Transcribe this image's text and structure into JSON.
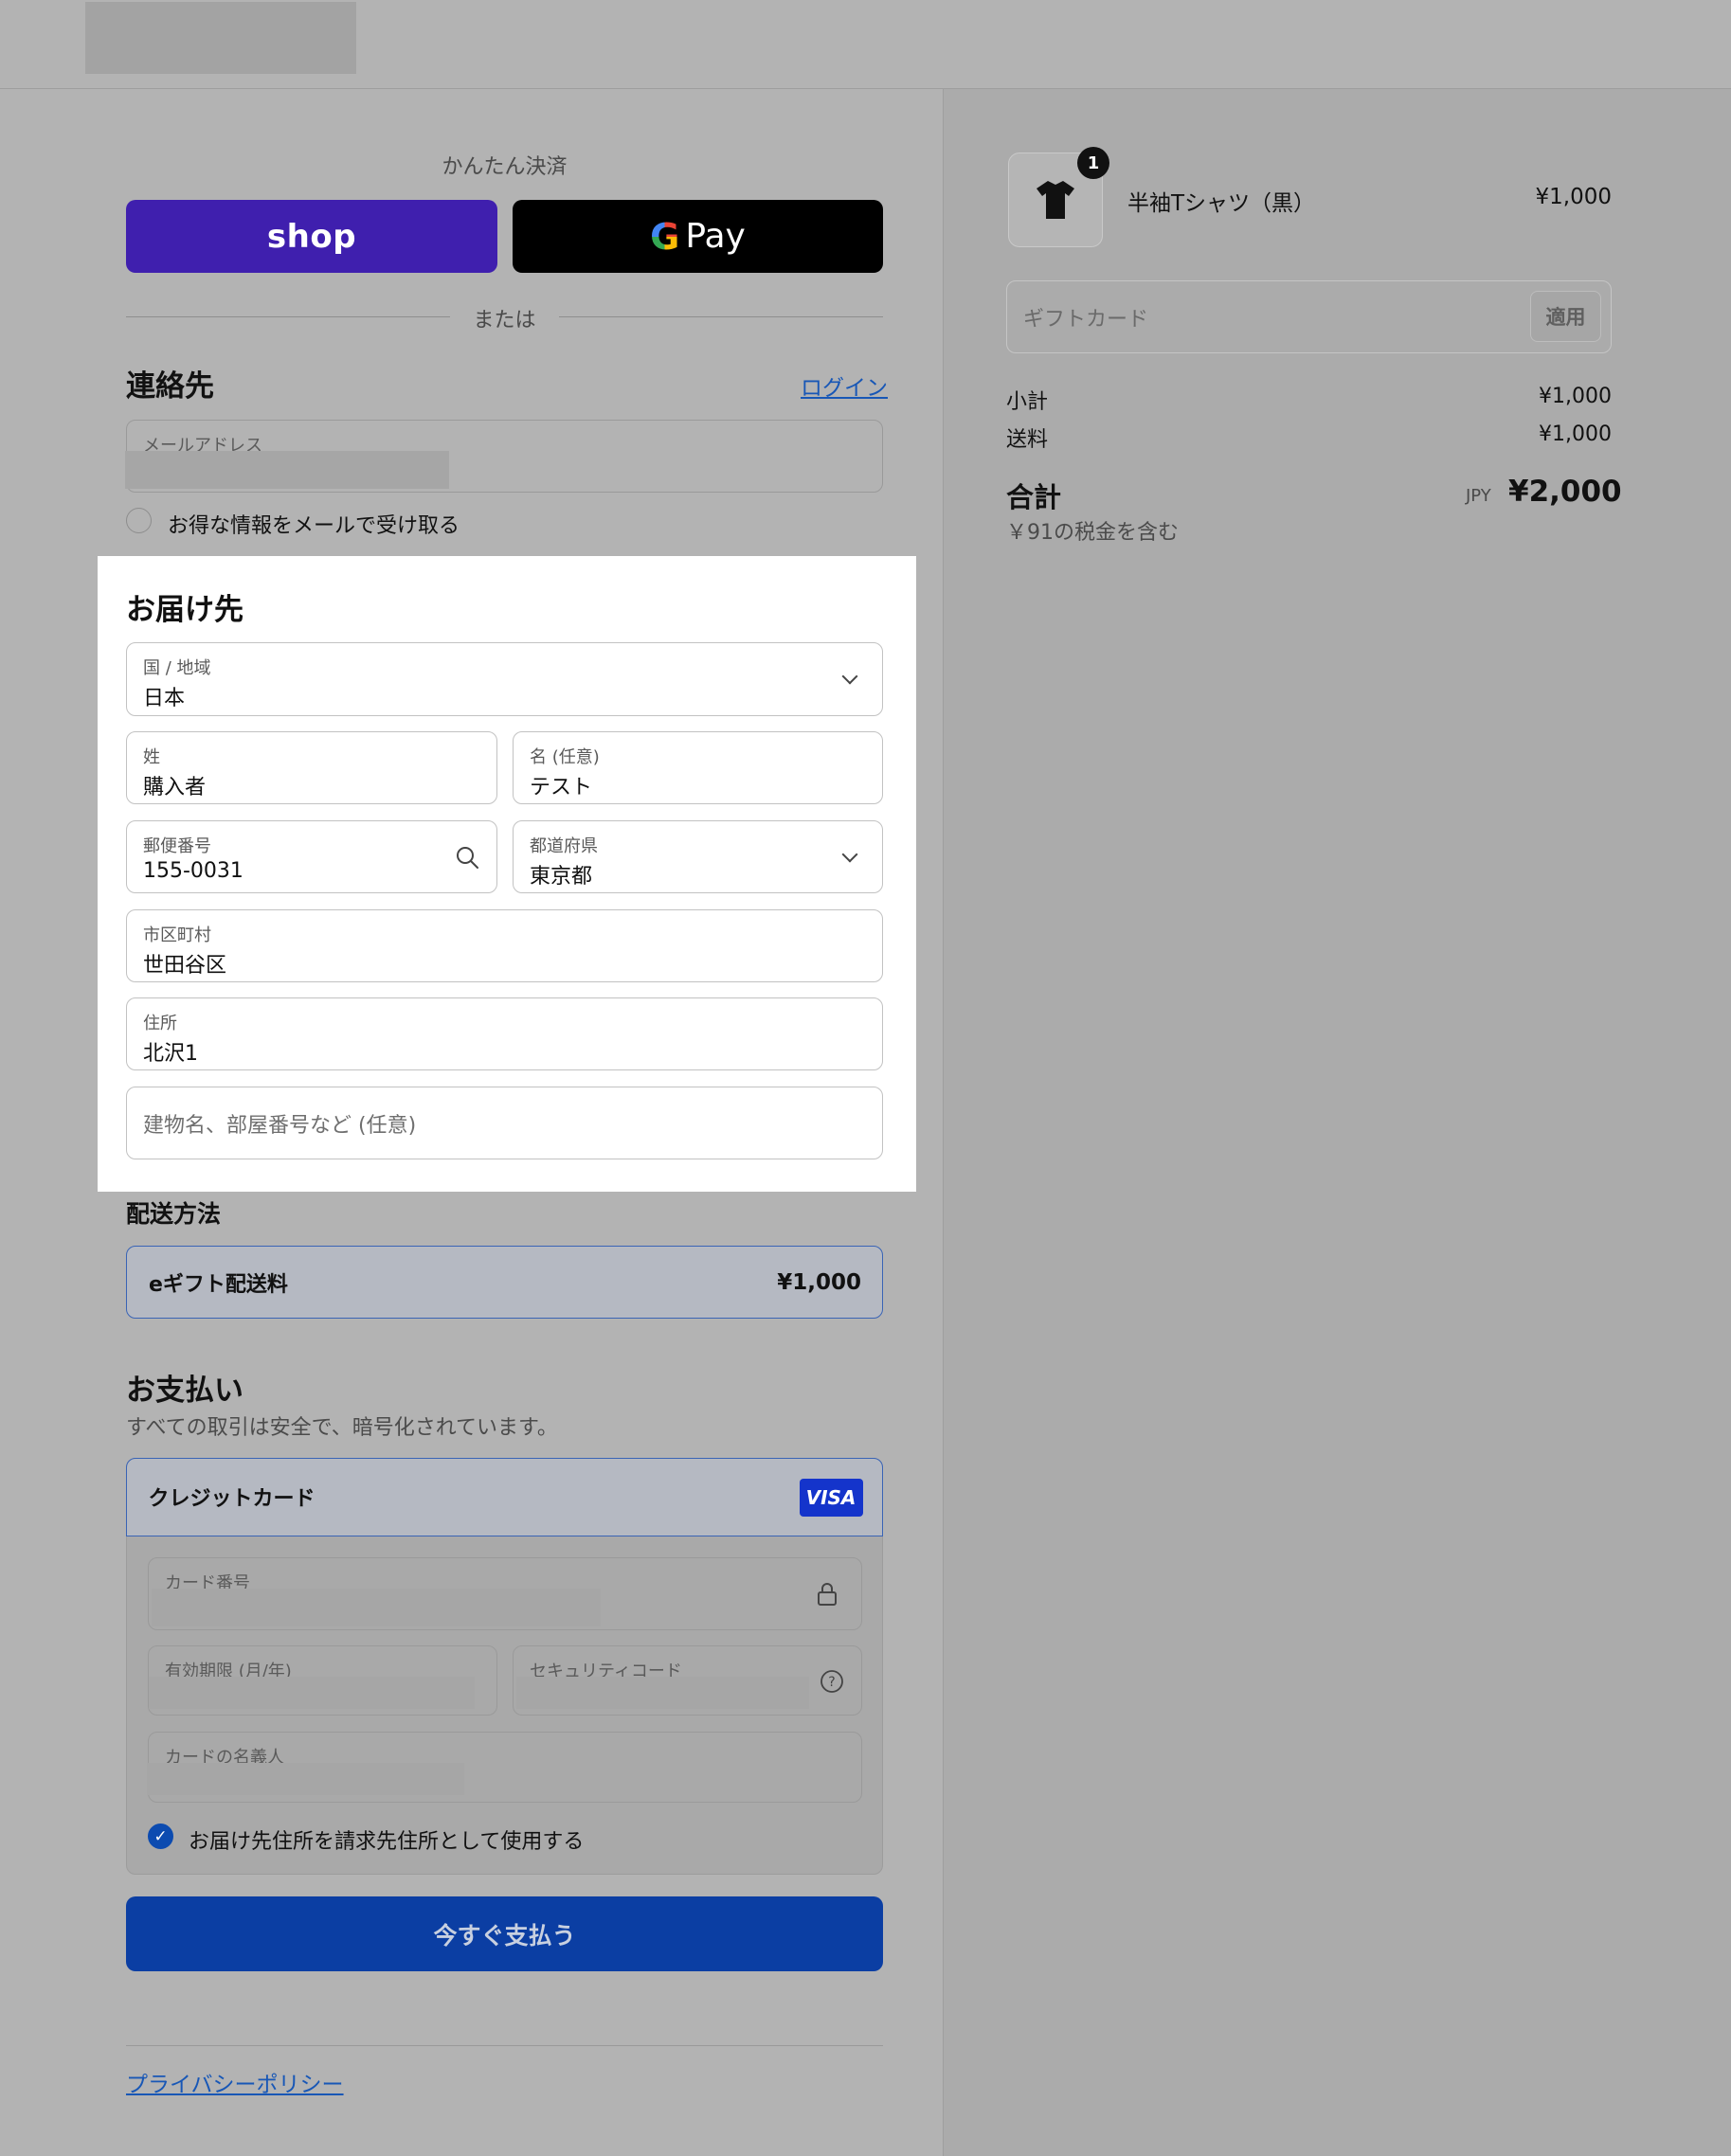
{
  "express": {
    "label": "かんたん決済",
    "shop_label": "shop",
    "gpay_g": "G",
    "gpay_label": "Pay"
  },
  "or_text": "または",
  "contact": {
    "heading": "連絡先",
    "login_link": "ログイン",
    "email_label": "メールアドレス",
    "newsletter_label": "お得な情報をメールで受け取る"
  },
  "delivery": {
    "heading": "お届け先",
    "country_label": "国 / 地域",
    "country_value": "日本",
    "last_name_label": "姓",
    "last_name_value": "購入者",
    "first_name_label": "名 (任意)",
    "first_name_value": "テスト",
    "postal_label": "郵便番号",
    "postal_value": "155-0031",
    "prefecture_label": "都道府県",
    "prefecture_value": "東京都",
    "city_label": "市区町村",
    "city_value": "世田谷区",
    "address_label": "住所",
    "address_value": "北沢1",
    "building_placeholder": "建物名、部屋番号など (任意)"
  },
  "shipping": {
    "heading": "配送方法",
    "method_name": "eギフト配送料",
    "method_price": "¥1,000"
  },
  "payment": {
    "heading": "お支払い",
    "subtitle": "すべての取引は安全で、暗号化されています。",
    "method_label": "クレジットカード",
    "card_brand": "VISA",
    "card_number_label": "カード番号",
    "expiry_label": "有効期限 (月/年)",
    "cvc_label": "セキュリティコード",
    "name_label": "カードの名義人",
    "billing_same_label": "お届け先住所を請求先住所として使用する",
    "pay_button": "今すぐ支払う"
  },
  "footer": {
    "privacy_link": "プライバシーポリシー"
  },
  "summary": {
    "item_quantity": "1",
    "item_name": "半袖Tシャツ（黒）",
    "item_price": "¥1,000",
    "gift_card_placeholder": "ギフトカード",
    "apply_button": "適用",
    "subtotal_label": "小計",
    "subtotal_value": "¥1,000",
    "shipping_label": "送料",
    "shipping_value": "¥1,000",
    "total_label": "合計",
    "currency": "JPY",
    "total_value": "¥2,000",
    "tax_note": "￥91の税金を含む"
  },
  "colors": {
    "accent": "#0b3ea3",
    "shop_purple": "#3f1fae",
    "link": "#1857b6"
  }
}
